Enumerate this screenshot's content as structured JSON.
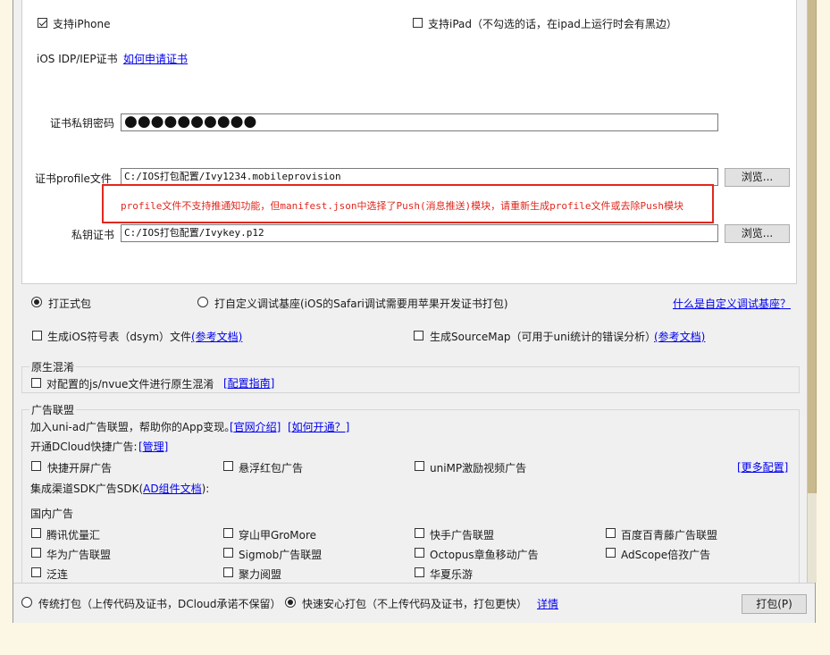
{
  "top": {
    "support_iphone": "支持iPhone",
    "support_ipad": "支持iPad（不勾选的话，在ipad上运行时会有黑边）",
    "cert_type_label": "iOS IDP/IEP证书",
    "how_to_apply": "如何申请证书",
    "password_label": "证书私钥密码",
    "password_value": "●●●●●●●●●●",
    "profile_label": "证书profile文件",
    "profile_value": "C:/IOS打包配置/Ivy1234.mobileprovision",
    "browse": "浏览...",
    "error_message": "profile文件不支持推通知功能，但manifest.json中选择了Push(消息推送)模块，请重新生成profile文件或去除Push模块",
    "private_cert_label": "私钥证书",
    "private_cert_value": "C:/IOS打包配置/Ivykey.p12"
  },
  "package_mode": {
    "formal": "打正式包",
    "custom_base": "打自定义调试基座(iOS的Safari调试需要用苹果开发证书打包)",
    "what_is_custom_base": "什么是自定义调试基座？"
  },
  "options": {
    "dsym": "生成iOS符号表（dsym）文件",
    "dsym_doc": "(参考文档)",
    "sourcemap": "生成SourceMap（可用于uni统计的错误分析）",
    "sourcemap_doc": "(参考文档)"
  },
  "obfuscation": {
    "title": "原生混淆",
    "option": "对配置的js/nvue文件进行原生混淆",
    "guide": "[配置指南]"
  },
  "ads": {
    "title": "广告联盟",
    "join_text": "加入uni-ad广告联盟，帮助你的App变现。",
    "official_intro": "[官网介绍]",
    "how_to_open": "[如何开通？]",
    "dcloud_ads_label": "开通DCloud快捷广告:",
    "manage": "[管理]",
    "splash": "快捷开屏广告",
    "floating_redpacket": "悬浮红包广告",
    "unimp_video": "uniMP激励视频广告",
    "more_config": "[更多配置]",
    "sdk_label_prefix": "集成渠道SDK广告SDK(",
    "ad_component_doc": "AD组件文档",
    "sdk_label_suffix": "):",
    "domestic": "国内广告",
    "networks": [
      "腾讯优量汇",
      "穿山甲GroMore",
      "快手广告联盟",
      "百度百青藤广告联盟",
      "华为广告联盟",
      "Sigmob广告联盟",
      "Octopus章鱼移动广告",
      "AdScope倍孜广告",
      "泛连",
      "聚力阅盟",
      "华夏乐游"
    ]
  },
  "footer": {
    "traditional": "传统打包（上传代码及证书，DCloud承诺不保留）",
    "safe_fast": "快速安心打包（不上传代码及证书，打包更快）",
    "details": "详情",
    "package_button": "打包(P)"
  }
}
